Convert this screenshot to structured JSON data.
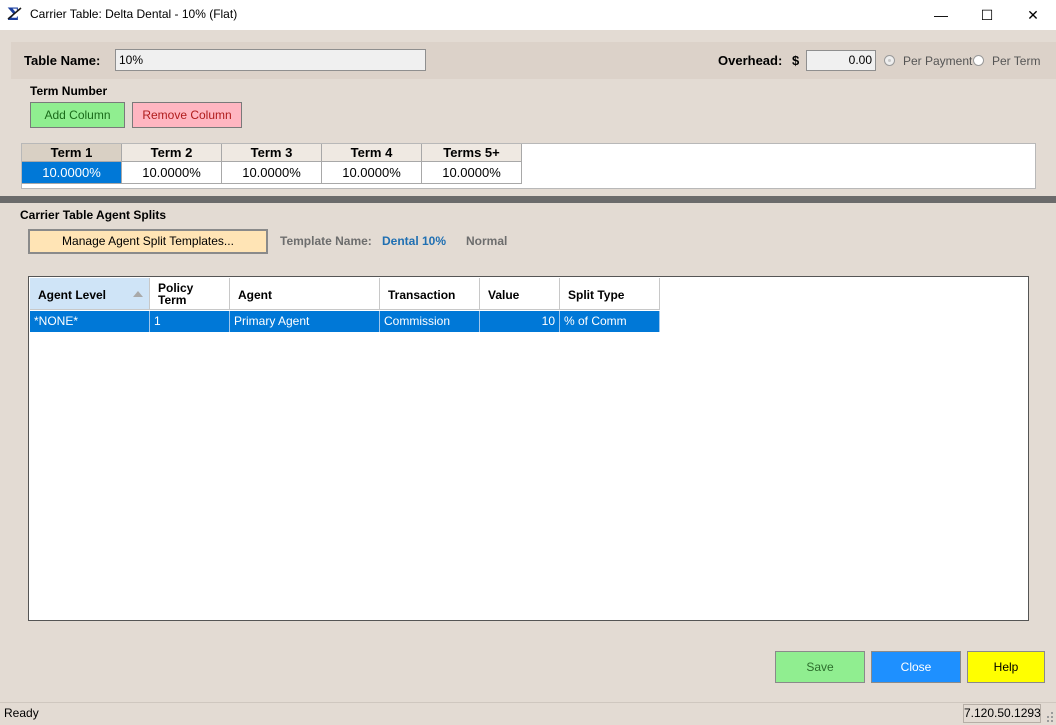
{
  "window": {
    "title": "Carrier Table: Delta Dental - 10% (Flat)",
    "controls": {
      "minimize": "—",
      "maximize": "☐",
      "close": "✕"
    }
  },
  "header": {
    "table_name_label": "Table Name:",
    "table_name_value": "10%",
    "overhead_label": "Overhead:",
    "currency_symbol": "$",
    "overhead_value": "0.00",
    "radio_per_payment": "Per Payment",
    "radio_per_term": "Per Term",
    "selected_radio": "Per Payment"
  },
  "term_section": {
    "label": "Term Number",
    "add_column": "Add Column",
    "remove_column": "Remove Column",
    "columns": [
      "Term 1",
      "Term 2",
      "Term 3",
      "Term 4",
      "Terms 5+"
    ],
    "values": [
      "10.0000%",
      "10.0000%",
      "10.0000%",
      "10.0000%",
      "10.0000%"
    ]
  },
  "splits": {
    "title": "Carrier Table Agent Splits",
    "manage_button": "Manage Agent Split Templates...",
    "template_name_label": "Template Name:",
    "template_name_value": "Dental 10%",
    "template_type": "Normal",
    "columns": [
      "Agent Level",
      "Policy\nTerm",
      "Agent",
      "Transaction",
      "Value",
      "Split Type"
    ],
    "column_policy_term_line1": "Policy",
    "column_policy_term_line2": "Term",
    "rows": [
      {
        "agent_level": "*NONE*",
        "policy_term": "1",
        "agent": "Primary Agent",
        "transaction": "Commission",
        "value": "10",
        "split_type": "% of Comm"
      }
    ]
  },
  "footer": {
    "save": "Save",
    "close": "Close",
    "help": "Help",
    "status": "Ready",
    "version": "7.120.50.1293"
  },
  "colors": {
    "selection": "#0078d7",
    "add_button": "#90ee90",
    "remove_button": "#ffb6c1",
    "manage_button": "#ffe4b5",
    "close_button": "#1e90ff",
    "help_button": "#ffff00",
    "template_name_value": "#1f6fb2"
  }
}
